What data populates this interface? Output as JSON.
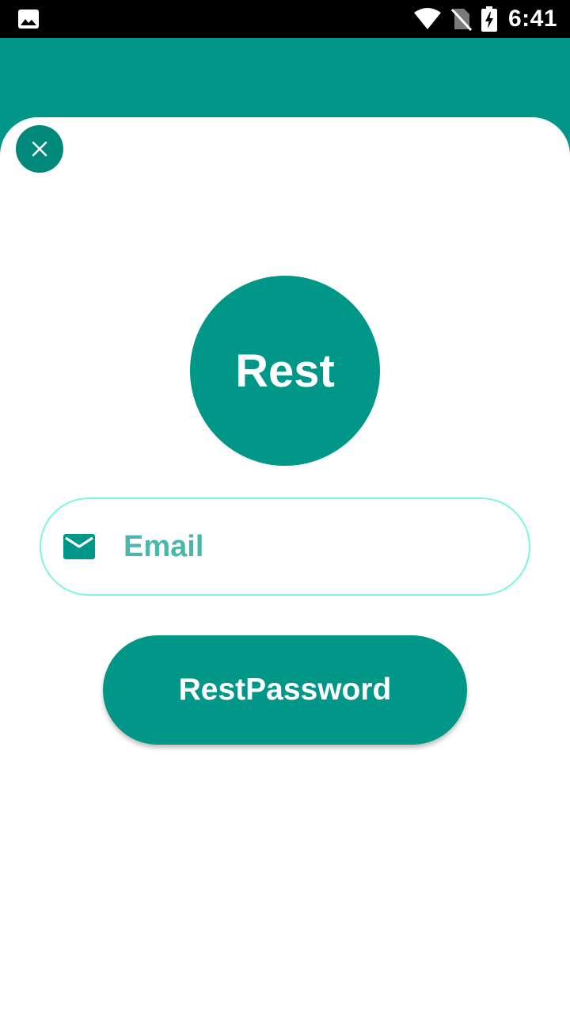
{
  "status_bar": {
    "time": "6:41",
    "icons": [
      "image-icon",
      "wifi-icon",
      "no-sim-icon",
      "battery-charging-icon"
    ]
  },
  "close_button": {
    "icon": "close-icon"
  },
  "logo": {
    "text": "Rest"
  },
  "email_field": {
    "icon": "mail-icon",
    "placeholder": "Email",
    "value": ""
  },
  "reset_button": {
    "label": "RestPassword"
  },
  "colors": {
    "primary": "#009688",
    "primary_dark": "#00897b",
    "field_border": "#7ff5e0",
    "placeholder": "#4db6ac",
    "background": "#ffffff"
  }
}
